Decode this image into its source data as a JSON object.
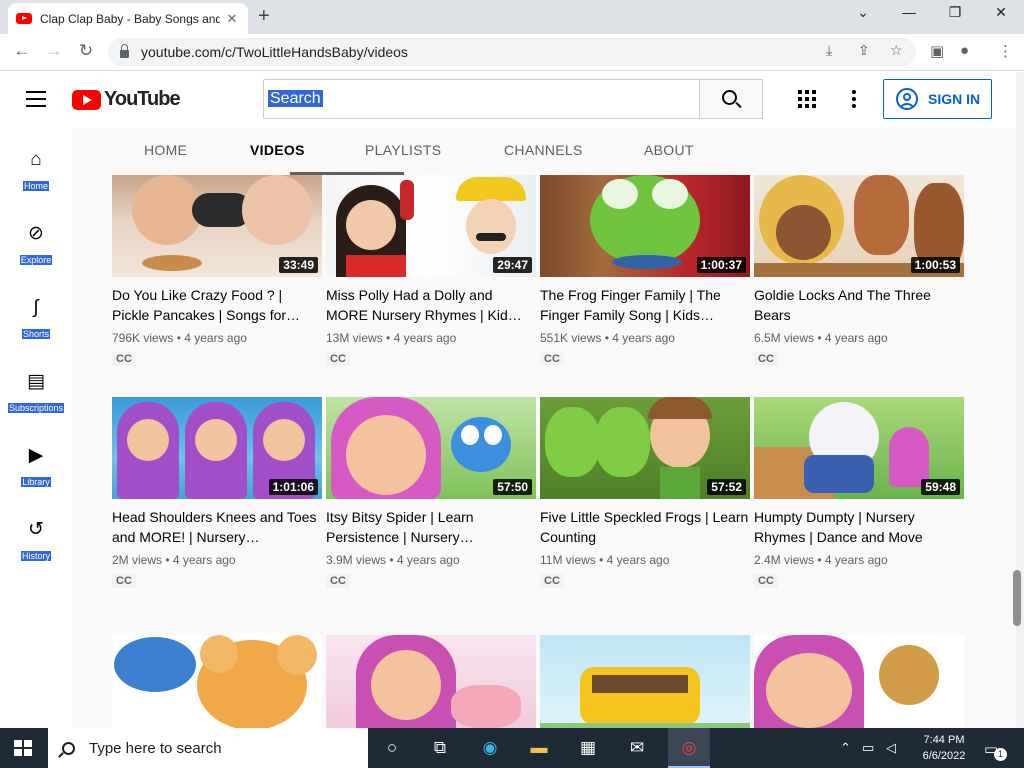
{
  "browser": {
    "tab_title": "Clap Clap Baby - Baby Songs and",
    "tab_close": "✕",
    "new_tab": "+",
    "url": "youtube.com/c/TwoLittleHandsBaby/videos",
    "window_controls": [
      "⌄",
      "—",
      "❐",
      "✕"
    ]
  },
  "header": {
    "logo_text": "YouTube",
    "search_value": "Search",
    "signin_label": "SIGN IN"
  },
  "sidebar": {
    "items": [
      {
        "label": "Home",
        "icon": "home-icon"
      },
      {
        "label": "Explore",
        "icon": "compass-icon"
      },
      {
        "label": "Shorts",
        "icon": "shorts-icon"
      },
      {
        "label": "Subscriptions",
        "icon": "subscriptions-icon"
      },
      {
        "label": "Library",
        "icon": "library-icon"
      },
      {
        "label": "History",
        "icon": "history-icon"
      }
    ]
  },
  "channel_tabs": [
    "HOME",
    "VIDEOS",
    "PLAYLISTS",
    "CHANNELS",
    "ABOUT"
  ],
  "active_tab": "VIDEOS",
  "videos": [
    {
      "title": "Do You Like Crazy Food ? | Pickle Pancakes | Songs for…",
      "views": "796K views",
      "age": "4 years ago",
      "duration": "33:49",
      "cc": "CC"
    },
    {
      "title": "Miss Polly Had a Dolly and MORE Nursery Rhymes | Kid…",
      "views": "13M views",
      "age": "4 years ago",
      "duration": "29:47",
      "cc": "CC"
    },
    {
      "title": "The Frog Finger Family | The Finger Family Song | Kids…",
      "views": "551K views",
      "age": "4 years ago",
      "duration": "1:00:37",
      "cc": "CC"
    },
    {
      "title": "Goldie Locks And The Three Bears",
      "views": "6.5M views",
      "age": "4 years ago",
      "duration": "1:00:53",
      "cc": "CC"
    },
    {
      "title": "Head Shoulders Knees and Toes and MORE! | Nursery…",
      "views": "2M views",
      "age": "4 years ago",
      "duration": "1:01:06",
      "cc": "CC"
    },
    {
      "title": "Itsy Bitsy Spider | Learn Persistence | Nursery…",
      "views": "3.9M views",
      "age": "4 years ago",
      "duration": "57:50",
      "cc": "CC"
    },
    {
      "title": "Five Little Speckled Frogs | Learn Counting",
      "views": "11M views",
      "age": "4 years ago",
      "duration": "57:52",
      "cc": "CC"
    },
    {
      "title": "Humpty Dumpty | Nursery Rhymes | Dance and Move",
      "views": "2.4M views",
      "age": "4 years ago",
      "duration": "59:48",
      "cc": "CC"
    }
  ],
  "taskbar": {
    "search_placeholder": "Type here to search",
    "time": "7:44 PM",
    "date": "6/6/2022",
    "notification_count": "1"
  }
}
